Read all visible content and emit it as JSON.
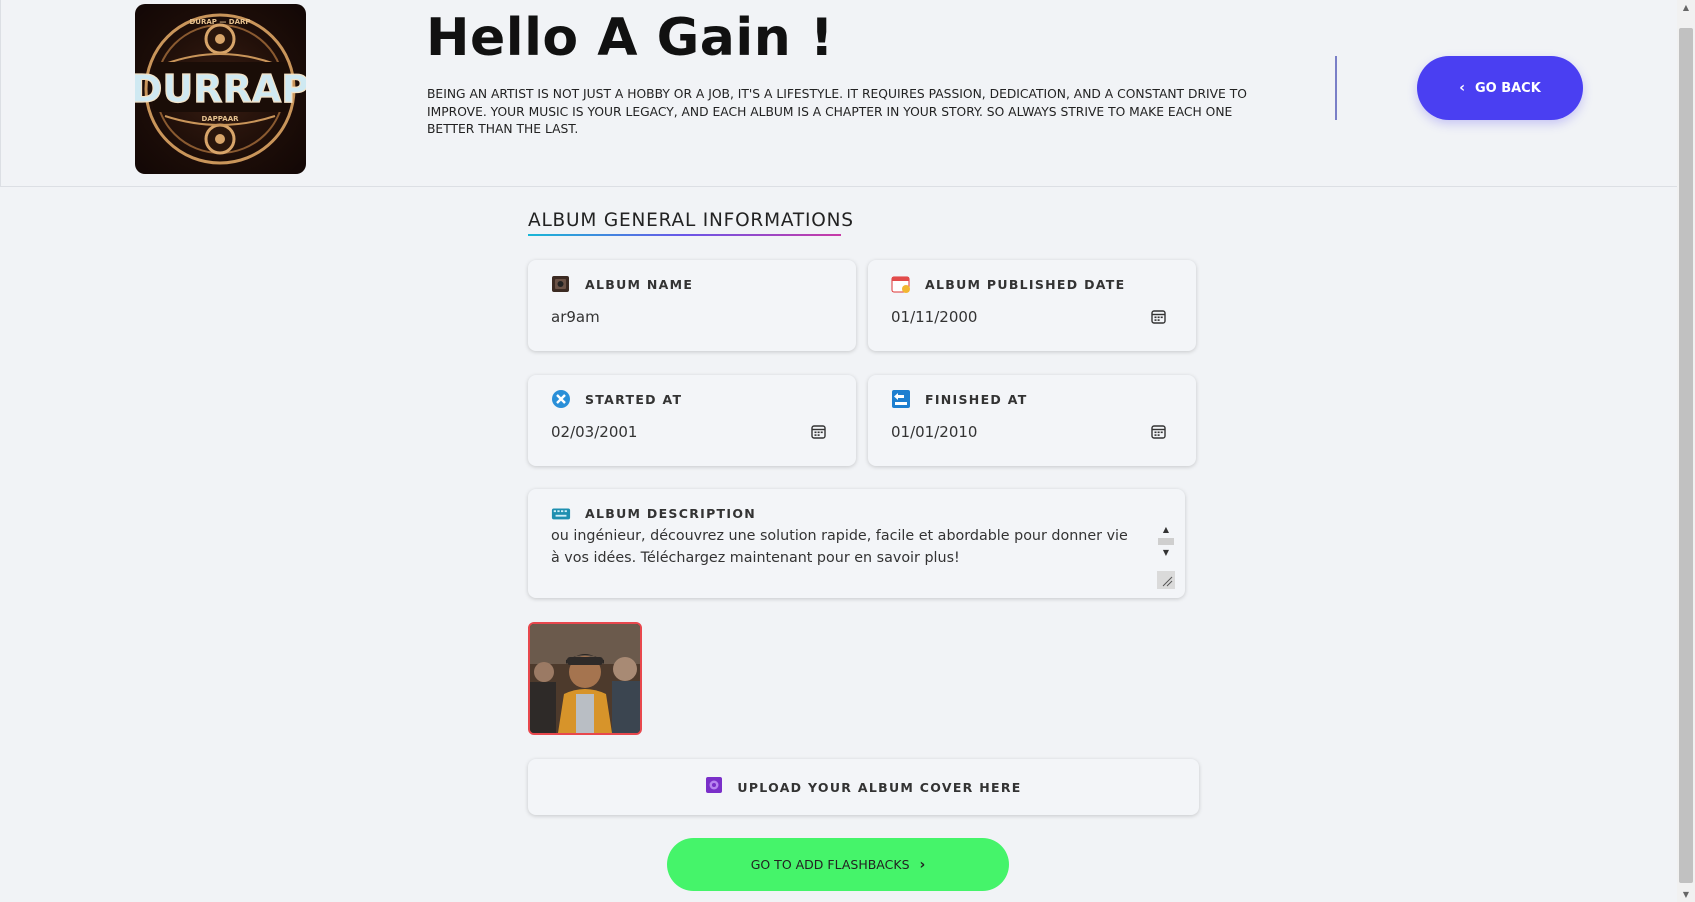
{
  "header": {
    "logo_text": "DURRAP",
    "logo_top_text": "DURAP — DARP",
    "logo_bottom_text": "DAPPAAR",
    "title": "Hello A Gain !",
    "intro": "BEING AN ARTIST IS NOT JUST A HOBBY OR A JOB, IT'S A LIFESTYLE. IT REQUIRES PASSION, DEDICATION, AND A CONSTANT DRIVE TO IMPROVE. YOUR MUSIC IS YOUR LEGACY, AND EACH ALBUM IS A CHAPTER IN YOUR STORY. SO ALWAYS STRIVE TO MAKE EACH ONE BETTER THAN THE LAST.",
    "go_back_label": "GO BACK"
  },
  "section": {
    "title": "ALBUM GENERAL INFORMATIONS"
  },
  "fields": {
    "album_name": {
      "label": "ALBUM NAME",
      "value": "ar9am"
    },
    "published_date": {
      "label": "ALBUM PUBLISHED DATE",
      "value": "01/11/2000"
    },
    "started_at": {
      "label": "STARTED AT",
      "value": "02/03/2001"
    },
    "finished_at": {
      "label": "FINISHED AT",
      "value": "01/01/2010"
    },
    "description": {
      "label": "ALBUM DESCRIPTION",
      "value": "ou ingénieur, découvrez une solution rapide, facile et abordable pour donner vie à vos idées. Téléchargez maintenant pour en savoir plus!"
    }
  },
  "upload": {
    "label": "UPLOAD YOUR ALBUM COVER HERE"
  },
  "next_button": {
    "label": "GO TO ADD FLASHBACKS"
  },
  "colors": {
    "accent": "#4a3ff2",
    "go_green": "#45f46a",
    "cover_border": "#e8474d"
  }
}
